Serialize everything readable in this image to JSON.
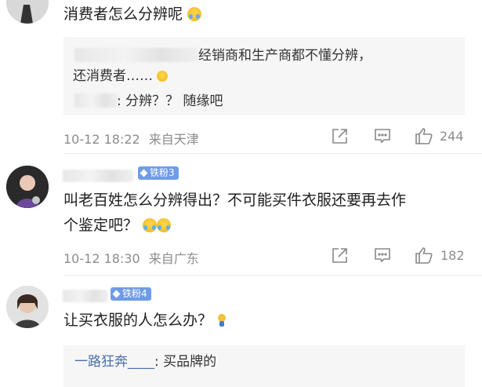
{
  "comments": [
    {
      "text": "消费者怎么分辨呢",
      "replies": [
        {
          "text": "经销商和生产商都不懂分辨，还消费者……"
        },
        {
          "text": ": 分辨？？ 随缘吧"
        }
      ],
      "time": "10-12 18:22",
      "source": "来自天津",
      "likes": "244"
    },
    {
      "badge": "铁粉3",
      "text_line1": "叫老百姓怎么分辨得出？不可能买件衣服还要再去作",
      "text_line2": "个鉴定吧？",
      "time": "10-12 18:30",
      "source": "来自广东",
      "likes": "182"
    },
    {
      "badge": "铁粉4",
      "text": "让买衣服的人怎么办？",
      "reply_user": "一路狂奔____",
      "reply_text": ": 买品牌的"
    }
  ],
  "icons": {
    "share": "share-icon",
    "comment": "comment-icon",
    "like": "thumbs-up-icon"
  }
}
